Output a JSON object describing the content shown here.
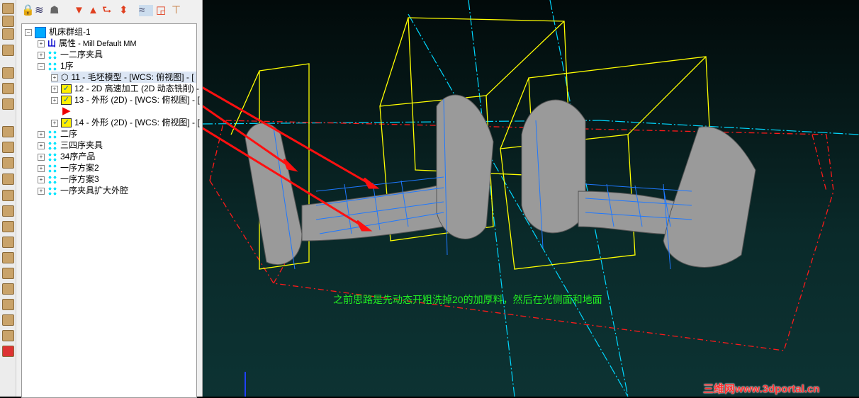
{
  "toolbar": {
    "icons": [
      "lock-icon",
      "waves-icon",
      "ghost-icon",
      "move-down-icon",
      "move-up-icon",
      "move-to-icon",
      "expand-collapse-icon",
      "select-toolpath-icon",
      "circle-square-icon",
      "tool-icon"
    ]
  },
  "tree": {
    "root": "机床群组-1",
    "props": {
      "label": "属性",
      "detail": " - Mill Default MM"
    },
    "items": [
      "一二序夹具",
      "1序"
    ],
    "ops": [
      "11 - 毛坯模型 - [WCS: 俯视图] - [",
      "12 - 2D 高速加工 (2D 动态铣削) - ",
      "13 - 外形 (2D) - [WCS: 俯视图] - [",
      "14 - 外形 (2D) - [WCS: 俯视图] - ["
    ],
    "groups": [
      "二序",
      "三四序夹具",
      "34序产品",
      "一序方案2",
      "一序方案3",
      "一序夹具扩大外腔"
    ]
  },
  "viewport": {
    "annotation": "之前思路是先动态开粗洗掉20的加厚料，然后在光侧面和地面",
    "watermark": "三维网www.3dportal.cn"
  },
  "colors": {
    "toolpath": "#1e78ff",
    "bounding": "#ffff00",
    "stock": "#ff2020",
    "axis": "#00e0ff",
    "note": "#22ee22"
  }
}
